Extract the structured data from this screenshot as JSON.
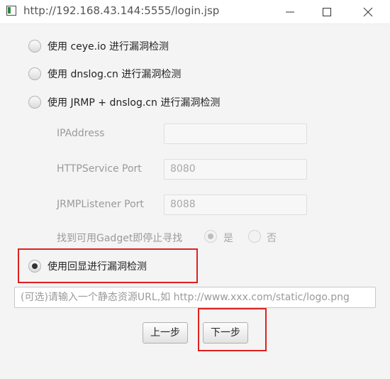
{
  "window": {
    "title": "http://192.168.43.144:5555/login.jsp"
  },
  "options": {
    "ceye": "使用 ceye.io 进行漏洞检测",
    "dnslog": "使用 dnslog.cn 进行漏洞检测",
    "jrmp": "使用 JRMP + dnslog.cn 进行漏洞检测",
    "echo": "使用回显进行漏洞检测"
  },
  "jrmp_config": {
    "ip_label": "IPAddress",
    "ip_value": "",
    "http_port_label": "HTTPService Port",
    "http_port_value": "8080",
    "jrmp_port_label": "JRMPListener Port",
    "jrmp_port_value": "8088",
    "gadget_label": "找到可用Gadget即停止寻找",
    "gadget_yes": "是",
    "gadget_no": "否"
  },
  "url_field": {
    "placeholder": "(可选)请输入一个静态资源URL,如 http://www.xxx.com/static/logo.png"
  },
  "buttons": {
    "prev": "上一步",
    "next": "下一步"
  },
  "selected_option": "echo",
  "gadget_selected": "yes",
  "colors": {
    "highlight": "#e02020",
    "background": "#f4f4f4"
  }
}
